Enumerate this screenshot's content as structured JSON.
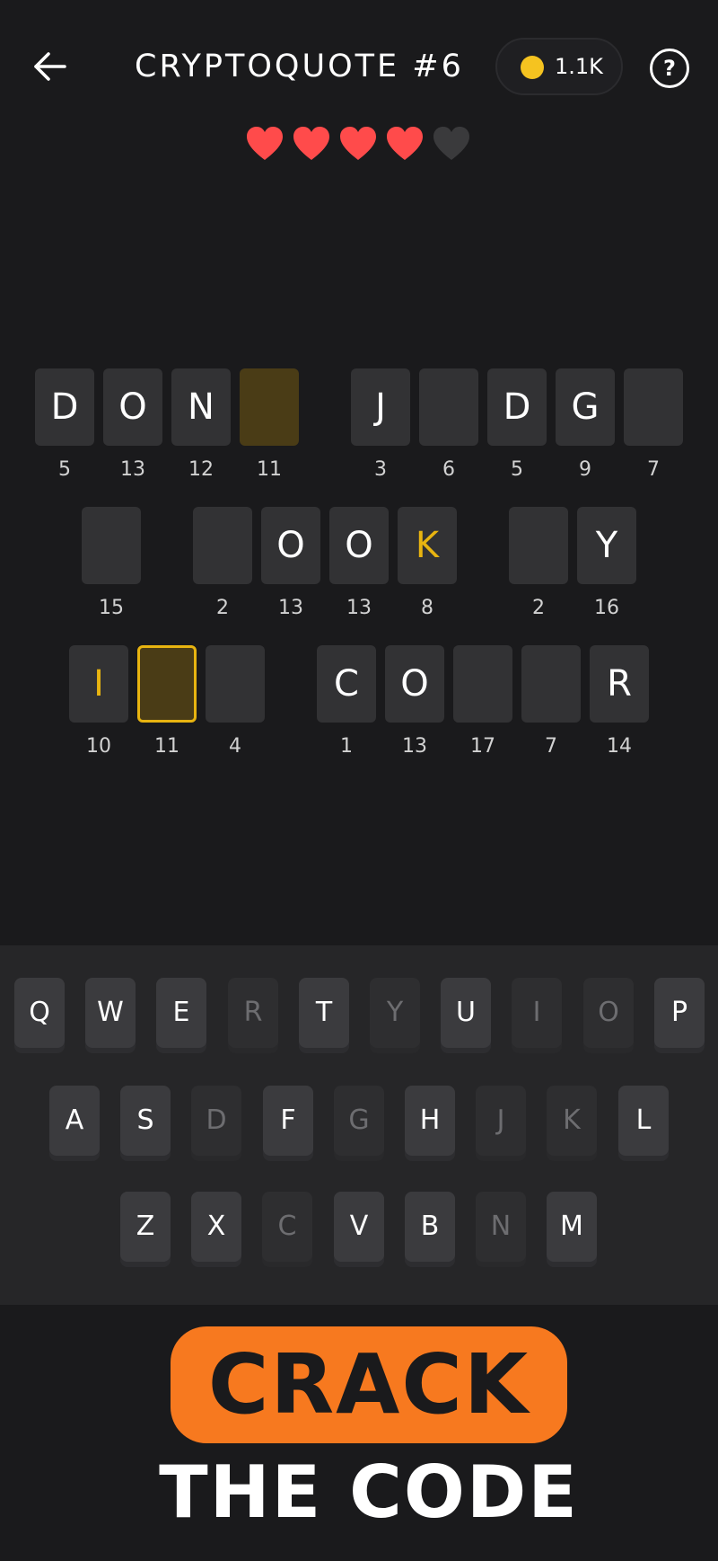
{
  "header": {
    "title": "CRYPTOQUOTE #6",
    "coins": "1.1K",
    "help_label": "?"
  },
  "lives": {
    "total": 5,
    "remaining": 4,
    "active_color": "#ff4b4b",
    "lost_color": "#3a3a3c"
  },
  "puzzle": {
    "rows": [
      {
        "words": [
          [
            {
              "letter": "D",
              "code": "5"
            },
            {
              "letter": "O",
              "code": "13"
            },
            {
              "letter": "N",
              "code": "12"
            },
            {
              "letter": "",
              "code": "11",
              "state": "group"
            }
          ],
          [
            {
              "letter": "J",
              "code": "3"
            },
            {
              "letter": "",
              "code": "6"
            },
            {
              "letter": "D",
              "code": "5"
            },
            {
              "letter": "G",
              "code": "9"
            },
            {
              "letter": "",
              "code": "7"
            }
          ]
        ]
      },
      {
        "words": [
          [
            {
              "letter": "",
              "code": "15"
            }
          ],
          [
            {
              "letter": "",
              "code": "2"
            },
            {
              "letter": "O",
              "code": "13"
            },
            {
              "letter": "O",
              "code": "13"
            },
            {
              "letter": "K",
              "code": "8",
              "state": "hint"
            }
          ],
          [
            {
              "letter": "",
              "code": "2"
            },
            {
              "letter": "Y",
              "code": "16"
            }
          ]
        ]
      },
      {
        "words": [
          [
            {
              "letter": "I",
              "code": "10",
              "state": "hint"
            },
            {
              "letter": "",
              "code": "11",
              "state": "selected"
            },
            {
              "letter": "",
              "code": "4"
            }
          ],
          [
            {
              "letter": "C",
              "code": "1"
            },
            {
              "letter": "O",
              "code": "13"
            },
            {
              "letter": "",
              "code": "17"
            },
            {
              "letter": "",
              "code": "7"
            },
            {
              "letter": "R",
              "code": "14"
            }
          ]
        ]
      }
    ],
    "colors": {
      "tile": "#323234",
      "group": "#4a3c16",
      "accent": "#e8b410"
    }
  },
  "keyboard": {
    "rows": [
      [
        {
          "k": "Q"
        },
        {
          "k": "W"
        },
        {
          "k": "E"
        },
        {
          "k": "R",
          "dim": true
        },
        {
          "k": "T"
        },
        {
          "k": "Y",
          "dim": true
        },
        {
          "k": "U"
        },
        {
          "k": "I",
          "dim": true
        },
        {
          "k": "O",
          "dim": true
        },
        {
          "k": "P"
        }
      ],
      [
        {
          "k": "A"
        },
        {
          "k": "S"
        },
        {
          "k": "D",
          "dim": true
        },
        {
          "k": "F"
        },
        {
          "k": "G",
          "dim": true
        },
        {
          "k": "H"
        },
        {
          "k": "J",
          "dim": true
        },
        {
          "k": "K",
          "dim": true
        },
        {
          "k": "L"
        }
      ],
      [
        {
          "k": "Z"
        },
        {
          "k": "X"
        },
        {
          "k": "C",
          "dim": true
        },
        {
          "k": "V"
        },
        {
          "k": "B"
        },
        {
          "k": "N",
          "dim": true
        },
        {
          "k": "M"
        }
      ]
    ]
  },
  "promo": {
    "banner": "CRACK",
    "tagline": "THE CODE",
    "banner_color": "#f7791f"
  }
}
